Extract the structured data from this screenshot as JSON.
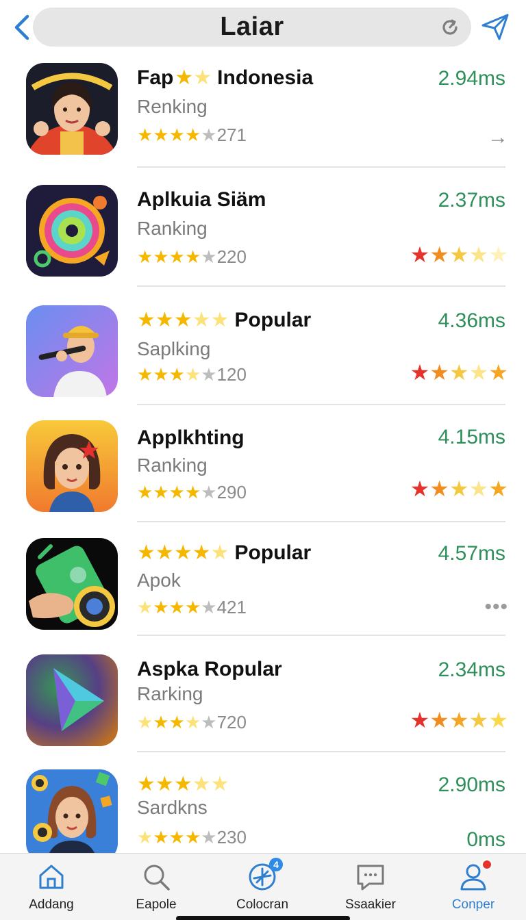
{
  "header": {
    "title": "Laiar",
    "back_icon": "chevron-left-icon",
    "refresh_icon": "refresh-icon",
    "send_icon": "paper-plane-icon",
    "accent": "#2f7fd0"
  },
  "apps": [
    {
      "title_prefix": "Fap",
      "title": "Indonesia",
      "subtitle": "Renking",
      "rating_count": "271",
      "latency": "2.94ms",
      "trailing": "arrow"
    },
    {
      "title_prefix": "",
      "title": "Aplkuia Siäm",
      "subtitle": "Ranking",
      "rating_count": "220",
      "latency": "2.37ms",
      "trailing": "stars"
    },
    {
      "title_prefix": "",
      "title": "Popular",
      "subtitle": "Saplking",
      "rating_count": "120",
      "latency": "4.36ms",
      "trailing": "stars"
    },
    {
      "title_prefix": "",
      "title": "Applkhting",
      "subtitle": "Ranking",
      "rating_count": "290",
      "latency": "4.15ms",
      "trailing": "stars"
    },
    {
      "title_prefix": "",
      "title": "Popular",
      "subtitle": "Apok",
      "rating_count": "421",
      "latency": "4.57ms",
      "trailing": "more"
    },
    {
      "title_prefix": "",
      "title": "Aspka Ropular",
      "subtitle": "Rarking",
      "rating_count": "720",
      "latency": "2.34ms",
      "trailing": "stars"
    },
    {
      "title_prefix": "",
      "title": "",
      "subtitle": "Sardkns",
      "rating_count": "230",
      "latency": "2.90ms",
      "latency2": "0ms",
      "trailing": "none"
    }
  ],
  "nav": [
    {
      "label": "Addang",
      "icon": "home-icon"
    },
    {
      "label": "Eapole",
      "icon": "search-icon"
    },
    {
      "label": "Colocran",
      "icon": "compass-icon",
      "badge": "4"
    },
    {
      "label": "Ssaakier",
      "icon": "chat-icon"
    },
    {
      "label": "Conper",
      "icon": "profile-icon"
    }
  ],
  "colors": {
    "latency_green": "#2f8f5a",
    "star_gold": "#f5b800",
    "star_red": "#e5322d",
    "nav_active": "#2f7fd0"
  }
}
